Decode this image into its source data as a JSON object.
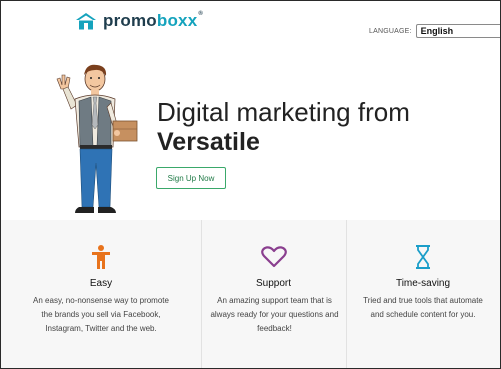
{
  "header": {
    "logo_part1": "promo",
    "logo_part2": "boxx",
    "logo_tm": "®",
    "language_label": "LANGUAGE:",
    "language_value": "English"
  },
  "hero": {
    "headline_line1": "Digital marketing from",
    "headline_line2": "Versatile",
    "signup_label": "Sign Up Now"
  },
  "features": [
    {
      "icon": "person-icon",
      "title": "Easy",
      "description": "An easy, no-nonsense way to promote the brands you sell via Facebook, Instagram, Twitter and the web."
    },
    {
      "icon": "heart-icon",
      "title": "Support",
      "description": "An amazing support team that is always ready for your questions and feedback!"
    },
    {
      "icon": "hourglass-icon",
      "title": "Time-saving",
      "description": "Tried and true tools that automate and schedule content for you."
    }
  ],
  "colors": {
    "brand_dark": "#1f3d4d",
    "brand_teal": "#15a3bd",
    "button_green": "#3aa86a",
    "easy_icon": "#e8731c",
    "support_icon": "#8a3f8f",
    "time_icon": "#1b9ec9"
  }
}
